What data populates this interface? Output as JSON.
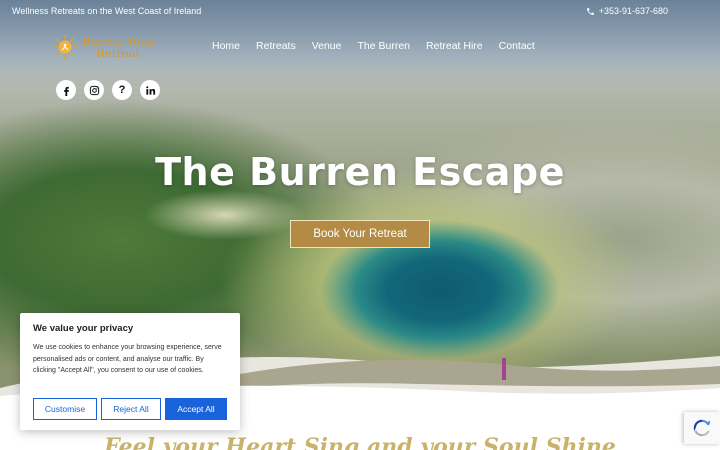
{
  "topbar": {
    "tagline": "Wellness Retreats on the West Coast of Ireland",
    "phone": "+353-91-637-680"
  },
  "logo": {
    "line1": "Burren Yoga",
    "line2": "Retreat"
  },
  "nav": {
    "items": [
      {
        "label": "Home"
      },
      {
        "label": "Retreats"
      },
      {
        "label": "Venue"
      },
      {
        "label": "The Burren"
      },
      {
        "label": "Retreat Hire"
      },
      {
        "label": "Contact"
      }
    ]
  },
  "socials": {
    "facebook": "facebook-icon",
    "instagram": "instagram-icon",
    "help_glyph": "?",
    "linkedin": "linkedin-icon"
  },
  "hero": {
    "title": "The Burren Escape",
    "cta": "Book Your Retreat"
  },
  "section": {
    "heading": "Feel your Heart Sing and your Soul Shine"
  },
  "cookie": {
    "title": "We value your privacy",
    "text": "We use cookies to enhance your browsing experience, serve personalised ads or content, and analyse our traffic. By clicking \"Accept All\", you consent to our use of cookies.",
    "customise": "Customise",
    "reject": "Reject All",
    "accept": "Accept All"
  },
  "colors": {
    "accent": "#b38b44",
    "logo": "#d49a2a",
    "cookie_button": "#1863dc",
    "script_heading": "#c9b36a"
  }
}
